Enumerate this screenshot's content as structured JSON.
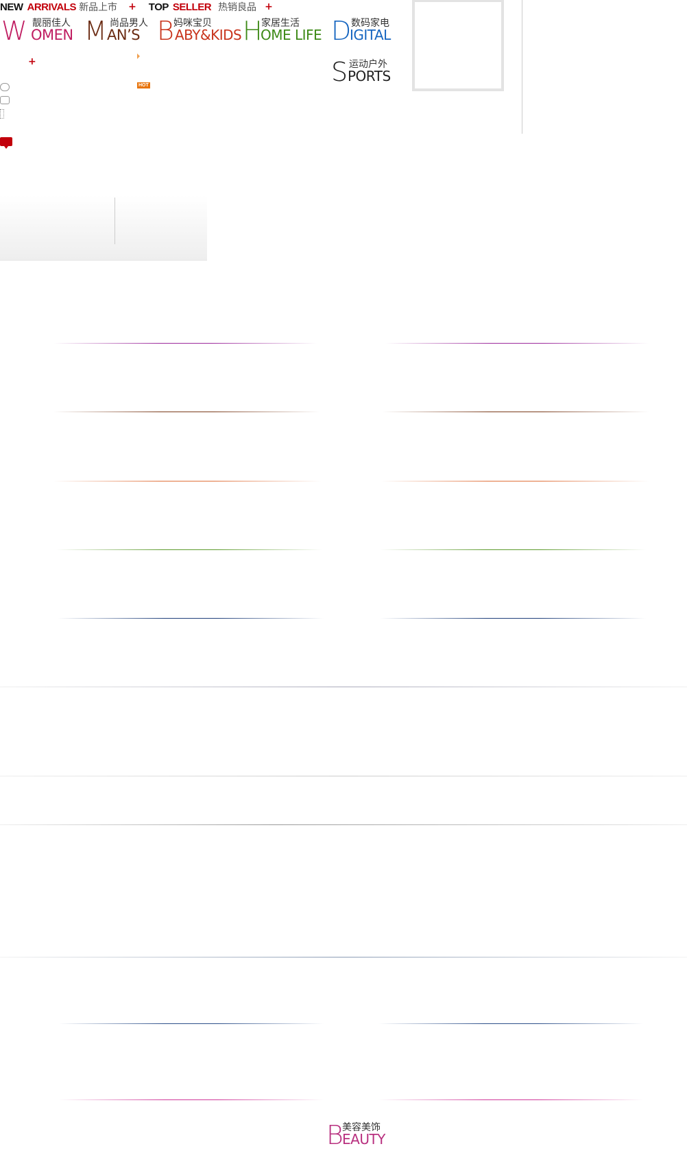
{
  "promo": {
    "new": "NEW",
    "arrivals": "ARRIVALS",
    "new_cn": "新品上市",
    "top": "TOP",
    "seller": "SELLER",
    "top_cn": "热销良品",
    "plus": "+"
  },
  "categories": {
    "women": {
      "cn": "靓丽佳人",
      "letter": "W",
      "rest": "OMEN",
      "color": "#c01e62"
    },
    "mans": {
      "cn": "尚品男人",
      "letter": "M",
      "rest": "AN’S",
      "color": "#6b2c13"
    },
    "baby": {
      "cn": "妈咪宝贝",
      "letter": "B",
      "rest": "ABY&KIDS",
      "color": "#c8331b"
    },
    "home": {
      "cn": "家居生活",
      "letter": "H",
      "rest": "OME LIFE",
      "color": "#3d8a16"
    },
    "digital": {
      "cn": "数码家电",
      "letter": "D",
      "rest": "IGITAL",
      "color": "#1565c0"
    },
    "sports": {
      "cn": "运动户外",
      "letter": "S",
      "rest": "PORTS",
      "color": "#222222"
    },
    "beauty": {
      "cn": "美容美饰",
      "letter": "B",
      "rest": "EAUTY",
      "color": "#b8307f"
    }
  },
  "hot_badge": "HOT",
  "colors": {
    "purple": "#9c2a9c",
    "brown": "#7a3a1a",
    "orange": "#e0703a",
    "green": "#5c9a2c",
    "navy": "#1f3f7a",
    "pink": "#d0399a",
    "gray": "#9aa0ad"
  }
}
